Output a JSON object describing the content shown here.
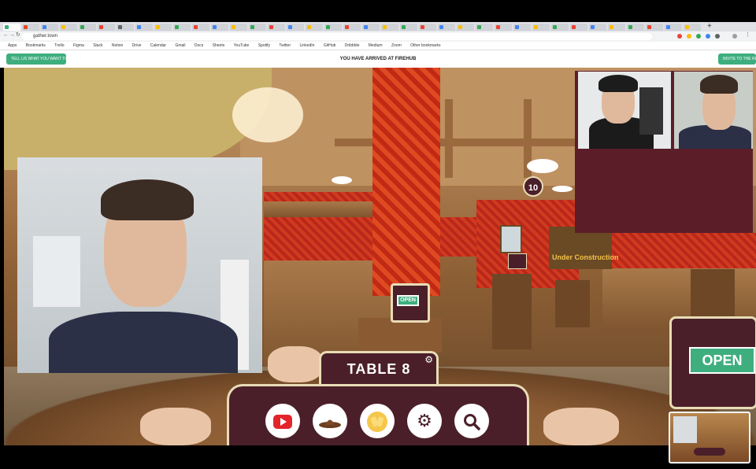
{
  "browser": {
    "url": "gather.town",
    "new_tab_label": "+",
    "bookmarks": [
      "Apps",
      "Bookmarks",
      "Trello",
      "Figma",
      "Slack",
      "Notion",
      "Drive",
      "Calendar",
      "Gmail",
      "Docs",
      "Sheets",
      "YouTube",
      "Spotify",
      "Twitter",
      "LinkedIn",
      "GitHub",
      "Dribbble",
      "Medium",
      "Zoom",
      "Other bookmarks"
    ]
  },
  "appbar": {
    "left_button": "TELL US WHAT YOU WANT TO PROMOTE",
    "title": "YOU HAVE ARRIVED AT FIREHUB",
    "right_button": "INVITE TO THE REAL"
  },
  "scene": {
    "table_title": "TABLE 8",
    "open_sign_small": "OPEN",
    "open_sign_large": "OPEN",
    "badge_number": "10",
    "construction_text": "Under Construction"
  },
  "dock": {
    "buttons": [
      {
        "name": "youtube",
        "icon": "youtube-icon"
      },
      {
        "name": "sombrero",
        "icon": "sombrero-icon"
      },
      {
        "name": "cheers",
        "icon": "cheers-icon"
      },
      {
        "name": "settings",
        "icon": "gear-icon"
      },
      {
        "name": "zoom",
        "icon": "zoom-icon"
      }
    ]
  },
  "colors": {
    "accent_green": "#3fae7f",
    "panel_maroon": "#4b1f2a",
    "panel_border": "#e8dcb6"
  }
}
